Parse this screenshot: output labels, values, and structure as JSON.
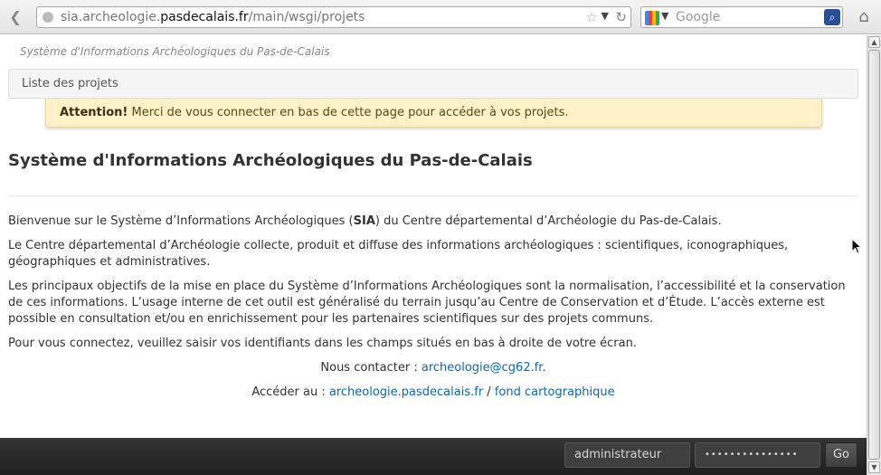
{
  "browser": {
    "url_prefix": "sia.archeologie.",
    "url_domain": "pasdecalais.fr",
    "url_path": "/main/wsgi/projets",
    "search_placeholder": "Google"
  },
  "page": {
    "site_title": "Système d'Informations Archéologiques du Pas-de-Calais",
    "breadcrumb": "Liste des projets",
    "alert_strong": "Attention!",
    "alert_text": " Merci de vous connecter en bas de cette page pour accéder à vos projets.",
    "heading": "Système d'Informations Archéologiques du Pas-de-Calais",
    "p1_a": "Bienvenue sur le Système d’Informations Archéologiques (",
    "p1_b": "SIA",
    "p1_c": ") du Centre départemental d’Archéologie du Pas-de-Calais.",
    "p2": "Le Centre départemental d’Archéologie collecte, produit et diffuse des informations archéologiques : scientifiques, iconographiques, géographiques et administratives.",
    "p3": "Les principaux objectifs de la mise en place du Système d’Informations Archéologiques sont la normalisation, l’accessibilité et la conservation de ces informations. L’usage interne de cet outil est généralisé du terrain jusqu’au Centre de Conservation et d’Étude. L’accès externe est possible en consultation et/ou en enrichissement pour les partenaires scientifiques sur des projets communs.",
    "p4": "Pour vous connectez, veuillez saisir vos identifiants dans les champs situés en bas à droite de votre écran.",
    "contact_label": "Nous contacter : ",
    "contact_email": "archeologie@cg62.fr",
    "contact_end": ".",
    "access_label": "Accéder au : ",
    "access_link1": "archeologie.pasdecalais.fr",
    "access_sep": " / ",
    "access_link2": "fond cartographique"
  },
  "login": {
    "username": "administrateur",
    "password_mask": "•••••••••••••••",
    "go_label": "Go"
  }
}
